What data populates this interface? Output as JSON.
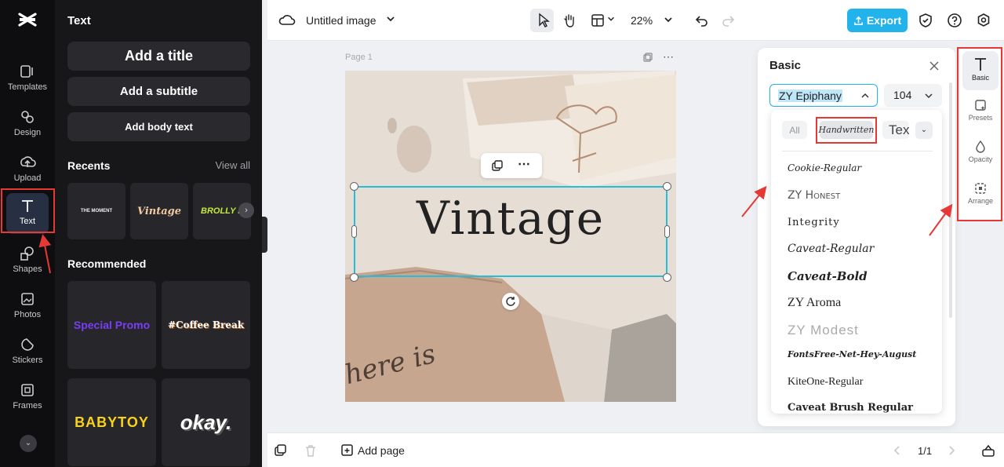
{
  "app": {
    "brand_icon": "capcut-logo-icon",
    "accent_color": "#22b3ec",
    "highlight_color": "#e53935"
  },
  "rail": {
    "items": [
      {
        "label": "Templates",
        "icon": "templates-icon"
      },
      {
        "label": "Design",
        "icon": "design-icon"
      },
      {
        "label": "Upload",
        "icon": "upload-icon"
      },
      {
        "label": "Text",
        "icon": "text-icon",
        "active": true
      },
      {
        "label": "Shapes",
        "icon": "shapes-icon"
      },
      {
        "label": "Photos",
        "icon": "photos-icon"
      },
      {
        "label": "Stickers",
        "icon": "stickers-icon"
      },
      {
        "label": "Frames",
        "icon": "frames-icon"
      }
    ]
  },
  "panel": {
    "title": "Text",
    "buttons": {
      "title": "Add a title",
      "subtitle": "Add a subtitle",
      "body": "Add body text"
    },
    "recents_title": "Recents",
    "view_all": "View all",
    "recents": [
      "THE MOMENT",
      "Vintage",
      "BROLLY HO"
    ],
    "recommended_title": "Recommended",
    "recommended": [
      "Special Promo",
      "#Coffee Break",
      "BABYTOY",
      "okay."
    ]
  },
  "topbar": {
    "doc_title": "Untitled image",
    "zoom": "22%",
    "export_label": "Export"
  },
  "canvas": {
    "page_label": "Page 1",
    "main_text": "Vintage",
    "bg_text": "here is"
  },
  "bottombar": {
    "add_page": "Add page",
    "page_count": "1/1"
  },
  "basic_panel": {
    "title": "Basic",
    "font_value": "ZY Epiphany",
    "size_value": "104",
    "filters": [
      "All",
      "Handwritten",
      "Tex"
    ],
    "fonts": [
      "Cookie-Regular",
      "ZY Honest",
      "Integrity",
      "Caveat-Regular",
      "Caveat-Bold",
      "ZY Aroma",
      "ZY Modest",
      "FontsFree-Net-Hey-August",
      "KiteOne-Regular",
      "Caveat Brush Regular"
    ]
  },
  "right_panel": {
    "items": [
      {
        "label": "Basic",
        "icon": "text-t-icon",
        "active": true
      },
      {
        "label": "Presets",
        "icon": "presets-icon"
      },
      {
        "label": "Opacity",
        "icon": "opacity-icon"
      },
      {
        "label": "Arrange",
        "icon": "arrange-icon"
      }
    ]
  }
}
